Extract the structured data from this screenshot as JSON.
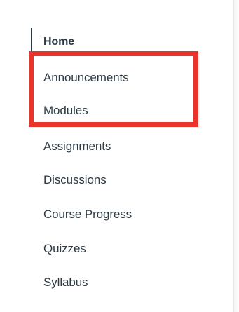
{
  "course_nav": {
    "items": [
      {
        "label": "Home",
        "active": true
      },
      {
        "label": "Announcements",
        "active": false
      },
      {
        "label": "Modules",
        "active": false
      },
      {
        "label": "Assignments",
        "active": false
      },
      {
        "label": "Discussions",
        "active": false
      },
      {
        "label": "Course Progress",
        "active": false
      },
      {
        "label": "Quizzes",
        "active": false
      },
      {
        "label": "Syllabus",
        "active": false
      }
    ]
  },
  "colors": {
    "text": "#2d3b45",
    "highlight": "#e8342a",
    "background": "#ffffff"
  }
}
